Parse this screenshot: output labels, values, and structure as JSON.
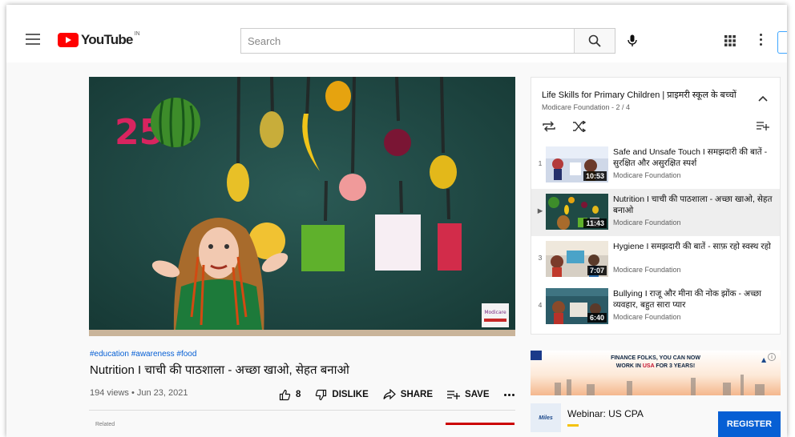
{
  "masthead": {
    "logo_text": "YouTube",
    "country_code": "IN",
    "search_placeholder": "Search"
  },
  "player": {
    "badge_number": "25",
    "corner_logo_text": "Modicare"
  },
  "video": {
    "hashtags": "#education #awareness #food",
    "title": "Nutrition I चाची की पाठशाला - अच्छा खाओ, सेहत बनाओ",
    "views_date": "194 views • Jun 23, 2021",
    "like_count": "8",
    "dislike_label": "DISLIKE",
    "share_label": "SHARE",
    "save_label": "SAVE"
  },
  "below_hint": "Related",
  "playlist": {
    "title": "Life Skills for Primary Children | प्राइमरी स्कूल के बच्चों",
    "subtitle": "Modicare Foundation - 2 / 4",
    "items": [
      {
        "index": "1",
        "title": "Safe and Unsafe Touch I समझदारी की बातें - सुरक्षित और असुरक्षित स्पर्श",
        "channel": "Modicare Foundation",
        "duration": "10:53",
        "active": false
      },
      {
        "index": "▶",
        "title": "Nutrition I चाची की पाठशाला - अच्छा खाओ, सेहत बनाओ",
        "channel": "Modicare Foundation",
        "duration": "11:43",
        "active": true
      },
      {
        "index": "3",
        "title": "Hygiene I समझदारी की बातें - साफ़ रहो स्वस्थ रहो",
        "channel": "Modicare Foundation",
        "duration": "7:07",
        "active": false
      },
      {
        "index": "4",
        "title": "Bullying I राजू और मीना की नोक झोंक - अच्छा व्यवहार, बहुत सारा प्यार",
        "channel": "Modicare Foundation",
        "duration": "6:40",
        "active": false
      }
    ]
  },
  "ad": {
    "banner_line1": "FINANCE FOLKS, YOU CAN NOW",
    "banner_line2_pre": "WORK IN ",
    "banner_line2_hl": "USA",
    "banner_line2_post": " FOR 3 YEARS!",
    "logo_text": "Miles",
    "text": "Webinar: US CPA",
    "button": "REGISTER"
  },
  "colors": {
    "accent": "#065fd4",
    "brand_red": "#ff0000",
    "board_green": "#1f4a45"
  }
}
